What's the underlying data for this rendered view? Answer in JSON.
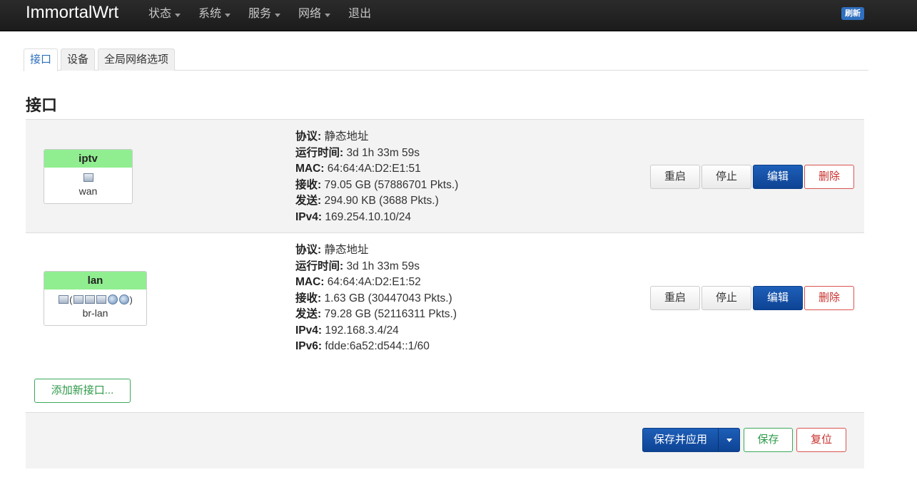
{
  "header": {
    "brand": "ImmortalWrt",
    "menu": [
      {
        "label": "状态",
        "dropdown": true
      },
      {
        "label": "系统",
        "dropdown": true
      },
      {
        "label": "服务",
        "dropdown": true
      },
      {
        "label": "网络",
        "dropdown": true
      },
      {
        "label": "退出",
        "dropdown": false
      }
    ],
    "refresh_badge": "刷新"
  },
  "tabs": [
    {
      "label": "接口",
      "active": true
    },
    {
      "label": "设备",
      "active": false
    },
    {
      "label": "全局网络选项",
      "active": false
    }
  ],
  "section_title": "接口",
  "interfaces": [
    {
      "name": "iptv",
      "device": "wan",
      "head_color": "#90ee90",
      "labels": {
        "protocol": "协议:",
        "uptime": "运行时间:",
        "mac": "MAC:",
        "rx": "接收:",
        "tx": "发送:",
        "ipv4": "IPv4:"
      },
      "protocol": "静态地址",
      "uptime": "3d 1h 33m 59s",
      "mac": "64:64:4A:D2:E1:51",
      "rx": "79.05 GB (57886701 Pkts.)",
      "tx": "294.90 KB (3688 Pkts.)",
      "ipv4": "169.254.10.10/24"
    },
    {
      "name": "lan",
      "device": "br-lan",
      "head_color": "#90ee90",
      "icons_text": "(",
      "icons_text_end": ")",
      "labels": {
        "protocol": "协议:",
        "uptime": "运行时间:",
        "mac": "MAC:",
        "rx": "接收:",
        "tx": "发送:",
        "ipv4": "IPv4:",
        "ipv6": "IPv6:"
      },
      "protocol": "静态地址",
      "uptime": "3d 1h 33m 59s",
      "mac": "64:64:4A:D2:E1:52",
      "rx": "1.63 GB (30447043 Pkts.)",
      "tx": "79.28 GB (52116311 Pkts.)",
      "ipv4": "192.168.3.4/24",
      "ipv6": "fdde:6a52:d544::1/60"
    }
  ],
  "row_actions": {
    "restart": "重启",
    "stop": "停止",
    "edit": "编辑",
    "delete": "删除"
  },
  "add_interface": "添加新接口...",
  "footer": {
    "save_apply": "保存并应用",
    "save": "保存",
    "reset": "复位"
  },
  "colors": {
    "primary": "#0d4394",
    "danger": "#d9534f",
    "success": "#3ba85a",
    "active_tab": "#2a6fbb"
  }
}
